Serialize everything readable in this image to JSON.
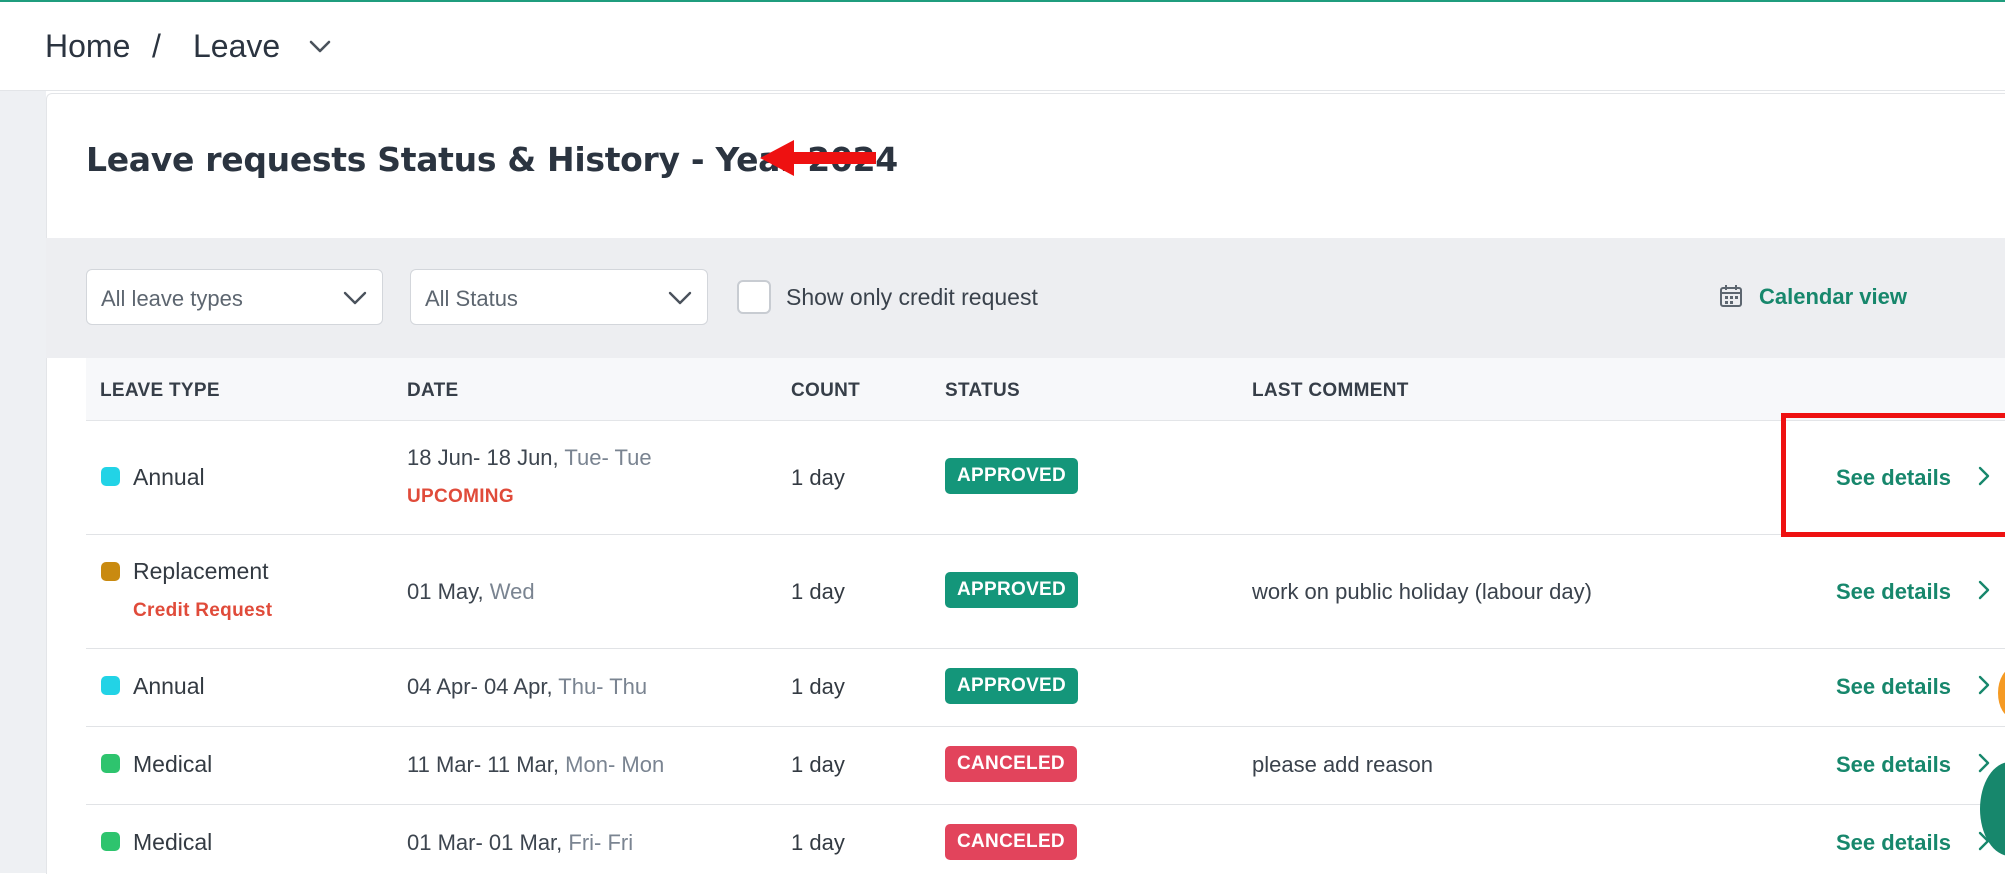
{
  "breadcrumb": {
    "home": "Home",
    "separator": "/",
    "current": "Leave"
  },
  "page": {
    "title": "Leave requests Status & History - Year 2024"
  },
  "filters": {
    "leave_type": "All leave types",
    "status": "All Status",
    "credit_checkbox_label": "Show only credit request",
    "credit_checkbox_checked": false,
    "calendar_link": "Calendar view"
  },
  "table": {
    "headers": [
      "LEAVE TYPE",
      "DATE",
      "COUNT",
      "STATUS",
      "LAST COMMENT"
    ],
    "rows": [
      {
        "type": "Annual",
        "type_color": "#22d3e6",
        "sub": "",
        "date": "18 Jun- 18 Jun",
        "days": "Tue- Tue",
        "tag": "UPCOMING",
        "count": "1 day",
        "status": "APPROVED",
        "comment": "",
        "action": "See details"
      },
      {
        "type": "Replacement",
        "type_color": "#c98a10",
        "sub": "Credit Request",
        "date": "01 May",
        "days": "Wed",
        "tag": "",
        "count": "1 day",
        "status": "APPROVED",
        "comment": "work on public holiday (labour day)",
        "action": "See details"
      },
      {
        "type": "Annual",
        "type_color": "#22d3e6",
        "sub": "",
        "date": "04 Apr- 04 Apr",
        "days": "Thu- Thu",
        "tag": "",
        "count": "1 day",
        "status": "APPROVED",
        "comment": "",
        "action": "See details"
      },
      {
        "type": "Medical",
        "type_color": "#2ec46e",
        "sub": "",
        "date": "11 Mar- 11 Mar",
        "days": "Mon- Mon",
        "tag": "",
        "count": "1 day",
        "status": "CANCELED",
        "comment": "please add reason",
        "action": "See details"
      },
      {
        "type": "Medical",
        "type_color": "#2ec46e",
        "sub": "",
        "date": "01 Mar- 01 Mar",
        "days": "Fri- Fri",
        "tag": "",
        "count": "1 day",
        "status": "CANCELED",
        "comment": "",
        "action": "See details"
      }
    ]
  },
  "colors": {
    "accent": "#17876c",
    "approved": "#14967a",
    "canceled": "#e2445c",
    "annotation": "#ee1111"
  }
}
